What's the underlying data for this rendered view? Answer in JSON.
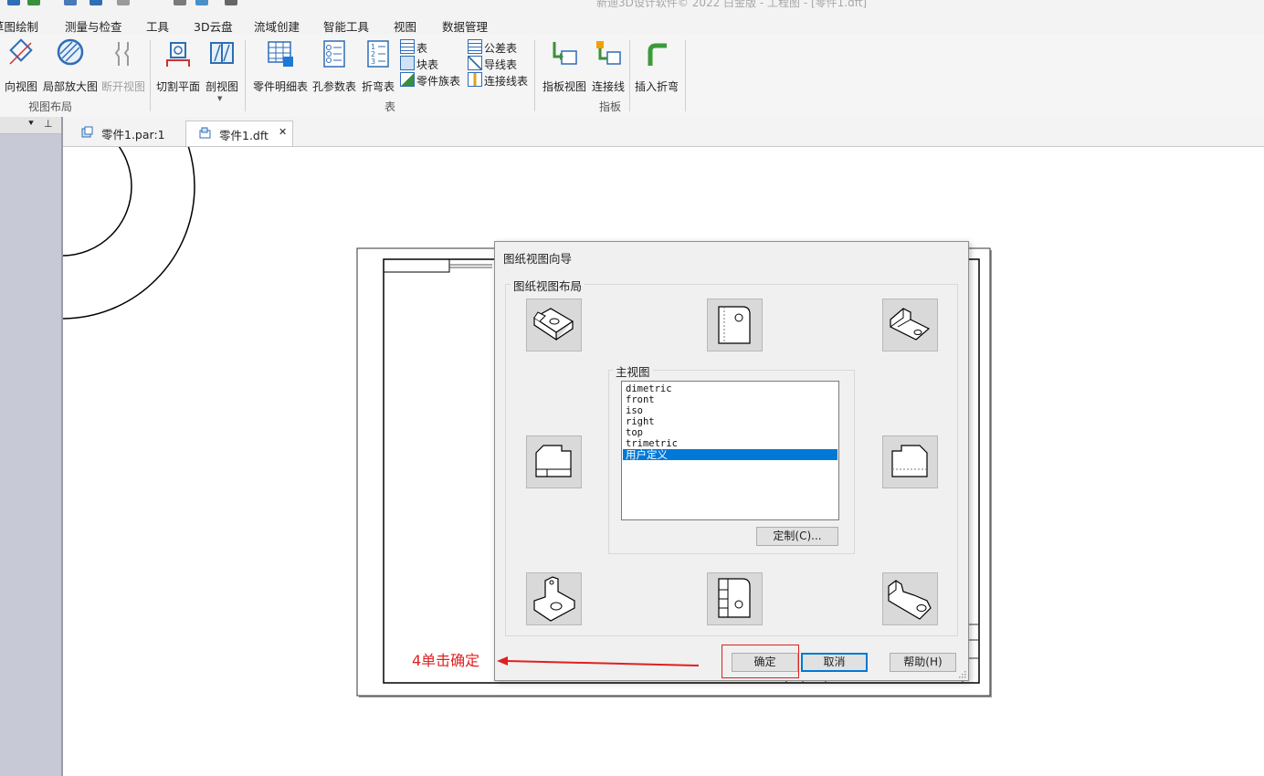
{
  "window": {
    "title": "新迪3D设计软件© 2022 白金版 - 工程图 - [零件1.dft]"
  },
  "menu": [
    "草图绘制",
    "测量与检查",
    "工具",
    "3D云盘",
    "流域创建",
    "智能工具",
    "视图",
    "数据管理"
  ],
  "ribbon": {
    "view_layout": {
      "buttons": [
        "向视图",
        "局部放大图",
        "断开视图",
        "切割平面",
        "剖视图"
      ],
      "group_label": "视图布局"
    },
    "table": {
      "buttons": [
        "零件明细表",
        "孔参数表",
        "折弯表"
      ],
      "small_items": [
        "表",
        "块表",
        "零件族表",
        "公差表",
        "导线表",
        "连接线表"
      ],
      "group_label": "表"
    },
    "pointer": {
      "buttons": [
        "指板视图",
        "连接线"
      ],
      "group_label": "指板"
    },
    "extra": {
      "buttons": [
        "插入折弯"
      ]
    }
  },
  "tabs": [
    {
      "label": "零件1.par:1",
      "active": false
    },
    {
      "label": "零件1.dft",
      "active": true,
      "close": "✕"
    }
  ],
  "left_pane": {
    "dropdown_glyph": "⯆",
    "pin_glyph": "⊥"
  },
  "dialog": {
    "title": "图纸视图向导",
    "layout_group_label": "图纸视图布局",
    "main_view_label": "主视图",
    "view_options": [
      "dimetric",
      "front",
      "iso",
      "right",
      "top",
      "trimetric",
      "用户定义"
    ],
    "selected_view": "用户定义",
    "customize_button": "定制(C)...",
    "ok_button": "确定",
    "cancel_button": "取消",
    "help_button": "帮助(H)"
  },
  "annotation": {
    "text": "4单击确定",
    "color": "#e02020"
  },
  "colors": {
    "selection": "#0078d7",
    "left_pane": "#c7c9d6",
    "accent": "#0078d7"
  }
}
